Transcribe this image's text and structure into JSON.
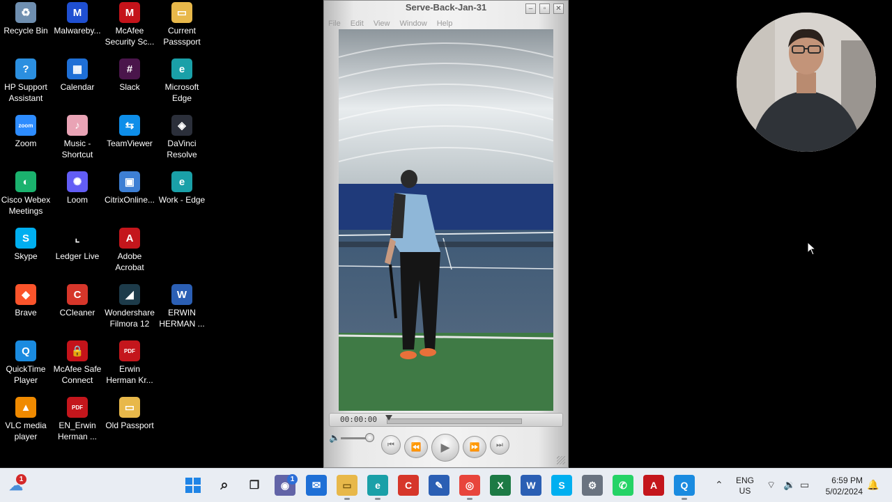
{
  "desktop_icons": [
    {
      "label": "Recycle Bin",
      "icon": "recycle-bin-icon",
      "color": "#6f8fb0",
      "glyph": "♻"
    },
    {
      "label": "Malwareby...",
      "icon": "malwarebytes-icon",
      "color": "#1f4fd1",
      "glyph": "M"
    },
    {
      "label": "McAfee\nSecurity Sc...",
      "icon": "mcafee-icon",
      "color": "#c4131a",
      "glyph": "M"
    },
    {
      "label": "Current\nPasssport",
      "icon": "folder-icon",
      "color": "#e8b84a",
      "glyph": "▭"
    },
    {
      "label": "HP Support\nAssistant",
      "icon": "hp-support-icon",
      "color": "#2b8fe0",
      "glyph": "?"
    },
    {
      "label": "Calendar",
      "icon": "calendar-icon",
      "color": "#1e6fd6",
      "glyph": "▦"
    },
    {
      "label": "Slack",
      "icon": "slack-icon",
      "color": "#4a154b",
      "glyph": "#"
    },
    {
      "label": "Microsoft\nEdge",
      "icon": "edge-icon",
      "color": "#1aa0a8",
      "glyph": "e"
    },
    {
      "label": "Zoom",
      "icon": "zoom-icon",
      "color": "#2d8cff",
      "glyph": "zoom"
    },
    {
      "label": "Music -\nShortcut",
      "icon": "music-folder-icon",
      "color": "#e9a3b5",
      "glyph": "♪"
    },
    {
      "label": "TeamViewer",
      "icon": "teamviewer-icon",
      "color": "#0e8ee9",
      "glyph": "⇆"
    },
    {
      "label": "DaVinci\nResolve",
      "icon": "davinci-icon",
      "color": "#2b2f3a",
      "glyph": "◈"
    },
    {
      "label": "Cisco Webex\nMeetings",
      "icon": "webex-icon",
      "color": "#1bb26e",
      "glyph": "◐"
    },
    {
      "label": "Loom",
      "icon": "loom-icon",
      "color": "#625df5",
      "glyph": "✺"
    },
    {
      "label": "CitrixOnline...",
      "icon": "citrix-icon",
      "color": "#3d7fd4",
      "glyph": "▣"
    },
    {
      "label": "Work - Edge",
      "icon": "edge-work-icon",
      "color": "#1aa0a8",
      "glyph": "e"
    },
    {
      "label": "Skype",
      "icon": "skype-icon",
      "color": "#00aff0",
      "glyph": "S"
    },
    {
      "label": "Ledger Live",
      "icon": "ledger-icon",
      "color": "#000000",
      "glyph": "⌞"
    },
    {
      "label": "Adobe\nAcrobat",
      "icon": "acrobat-icon",
      "color": "#c4161c",
      "glyph": "A"
    },
    {
      "label": "Brave",
      "icon": "brave-icon",
      "color": "#fb542b",
      "glyph": "◆"
    },
    {
      "label": "CCleaner",
      "icon": "ccleaner-icon",
      "color": "#d6362a",
      "glyph": "C"
    },
    {
      "label": "Wondershare\nFilmora 12",
      "icon": "filmora-icon",
      "color": "#1d3b4a",
      "glyph": "◢"
    },
    {
      "label": "ERWIN\nHERMAN ...",
      "icon": "word-doc-icon",
      "color": "#2b5fb4",
      "glyph": "W"
    },
    {
      "label": "QuickTime\nPlayer",
      "icon": "quicktime-icon",
      "color": "#1a8be0",
      "glyph": "Q"
    },
    {
      "label": "McAfee Safe\nConnect",
      "icon": "mcafee-safe-icon",
      "color": "#c4131a",
      "glyph": "🔒"
    },
    {
      "label": "Erwin\nHerman Kr...",
      "icon": "pdf-icon",
      "color": "#c4161c",
      "glyph": "PDF"
    },
    {
      "label": "VLC media\nplayer",
      "icon": "vlc-icon",
      "color": "#f08a00",
      "glyph": "▲"
    },
    {
      "label": "EN_Erwin\nHerman ...",
      "icon": "pdf-icon",
      "color": "#c4161c",
      "glyph": "PDF"
    },
    {
      "label": "Old Passport",
      "icon": "folder-icon",
      "color": "#e8b84a",
      "glyph": "▭"
    }
  ],
  "player": {
    "title": "Serve-Back-Jan-31",
    "menu": [
      "File",
      "Edit",
      "View",
      "Window",
      "Help"
    ],
    "timecode": "00:00:00"
  },
  "taskbar": {
    "notification_badge": "1",
    "teams_badge": "1",
    "language": "ENG",
    "region": "US",
    "time": "6:59 PM",
    "date": "5/02/2024"
  }
}
